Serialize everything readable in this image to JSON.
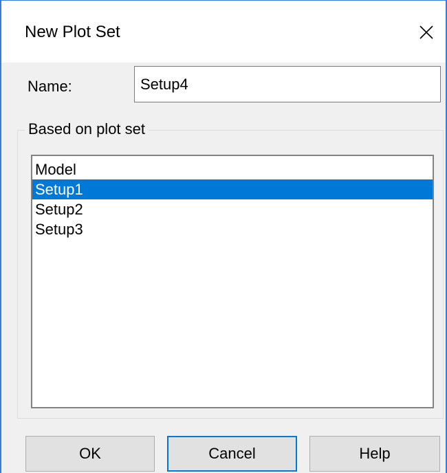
{
  "window": {
    "title": "New Plot Set",
    "close_icon": "close-icon"
  },
  "name_field": {
    "label": "Name:",
    "value": "Setup4"
  },
  "based_on": {
    "legend": "Based on plot set",
    "items": [
      {
        "label": "Model",
        "selected": false
      },
      {
        "label": "Setup1",
        "selected": true
      },
      {
        "label": "Setup2",
        "selected": false
      },
      {
        "label": "Setup3",
        "selected": false
      }
    ]
  },
  "buttons": {
    "ok": "OK",
    "cancel": "Cancel",
    "help": "Help"
  },
  "colors": {
    "accent": "#0078d7",
    "window_border": "#3a7bd5",
    "background": "#f0f0f0"
  }
}
